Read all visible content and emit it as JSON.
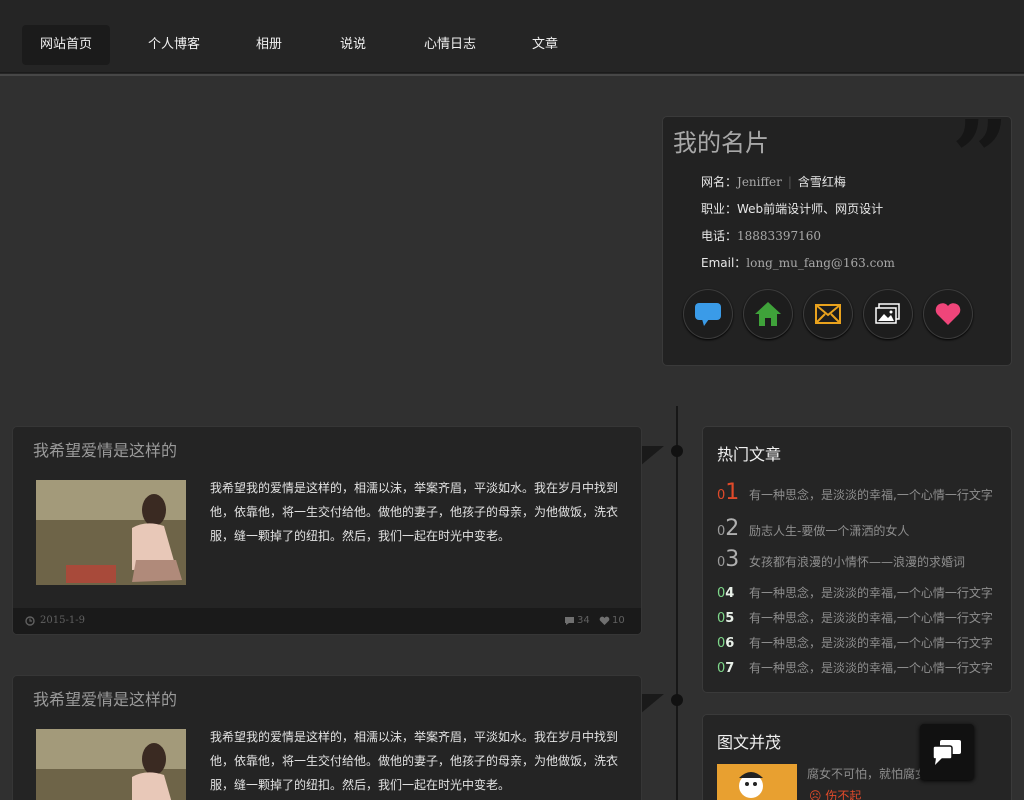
{
  "nav": {
    "items": [
      {
        "label": "网站首页",
        "active": true
      },
      {
        "label": "个人博客",
        "active": false
      },
      {
        "label": "相册",
        "active": false
      },
      {
        "label": "说说",
        "active": false
      },
      {
        "label": "心情日志",
        "active": false
      },
      {
        "label": "文章",
        "active": false
      }
    ]
  },
  "card": {
    "title": "我的名片",
    "name_label": "网名：",
    "name_value": "Jeniffer",
    "name_sep": "|",
    "name_alt": "含雪红梅",
    "job_label": "职业：",
    "job_value": "Web前端设计师、网页设计",
    "phone_label": "电话：",
    "phone_value": "18883397160",
    "email_label": "Email：",
    "email_value": "long_mu_fang@163.com",
    "icons": [
      "chat-icon",
      "home-icon",
      "mail-icon",
      "gallery-icon",
      "heart-icon"
    ],
    "icon_colors": {
      "chat": "#3a9be8",
      "home": "#3fa23a",
      "mail": "#e9a21d",
      "gallery": "#ffffff",
      "heart": "#f0457a"
    }
  },
  "posts": [
    {
      "title": "我希望爱情是这样的",
      "text": "我希望我的爱情是这样的，相濡以沫，举案齐眉，平淡如水。我在岁月中找到他，依靠他，将一生交付给他。做他的妻子，他孩子的母亲，为他做饭，洗衣服，缝一颗掉了的纽扣。然后，我们一起在时光中变老。",
      "date": "2015-1-9",
      "comments": "34",
      "likes": "10"
    },
    {
      "title": "我希望爱情是这样的",
      "text": "我希望我的爱情是这样的，相濡以沫，举案齐眉，平淡如水。我在岁月中找到他，依靠他，将一生交付给他。做他的妻子，他孩子的母亲，为他做饭，洗衣服，缝一颗掉了的纽扣。然后，我们一起在时光中变老。"
    }
  ],
  "hot": {
    "title": "热门文章",
    "items": [
      {
        "prefix": "0",
        "num": "1",
        "text": "有一种思念，是淡淡的幸福,一个心情一行文字"
      },
      {
        "prefix": "0",
        "num": "2",
        "text": "励志人生-要做一个潇洒的女人"
      },
      {
        "prefix": "0",
        "num": "3",
        "text": "女孩都有浪漫的小情怀——浪漫的求婚词"
      },
      {
        "prefix": "0",
        "num": "4",
        "text": "有一种思念，是淡淡的幸福,一个心情一行文字"
      },
      {
        "prefix": "0",
        "num": "5",
        "text": "有一种思念，是淡淡的幸福,一个心情一行文字"
      },
      {
        "prefix": "0",
        "num": "6",
        "text": "有一种思念，是淡淡的幸福,一个心情一行文字"
      },
      {
        "prefix": "0",
        "num": "7",
        "text": "有一种思念，是淡淡的幸福,一个心情一行文字"
      }
    ]
  },
  "pics": {
    "title": "图文并茂",
    "item_text": "腐女不可怕，就怕腐女",
    "item_tag": "伤不起"
  }
}
